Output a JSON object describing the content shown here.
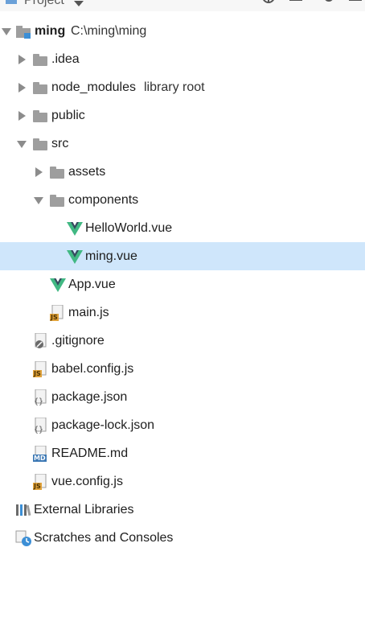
{
  "header": {
    "title": "Project"
  },
  "tree": {
    "root": {
      "label": "ming",
      "path": "C:\\ming\\ming"
    },
    "idea": {
      "label": ".idea"
    },
    "node_modules": {
      "label": "node_modules",
      "extra": "library root"
    },
    "public": {
      "label": "public"
    },
    "src": {
      "label": "src"
    },
    "assets": {
      "label": "assets"
    },
    "components": {
      "label": "components"
    },
    "helloworld": {
      "label": "HelloWorld.vue"
    },
    "ming_vue": {
      "label": "ming.vue"
    },
    "app_vue": {
      "label": "App.vue"
    },
    "main_js": {
      "label": "main.js"
    },
    "gitignore": {
      "label": ".gitignore"
    },
    "babel_config": {
      "label": "babel.config.js"
    },
    "package_json": {
      "label": "package.json"
    },
    "package_lock": {
      "label": "package-lock.json"
    },
    "readme": {
      "label": "README.md"
    },
    "vue_config": {
      "label": "vue.config.js"
    },
    "external_libraries": {
      "label": "External Libraries"
    },
    "scratches": {
      "label": "Scratches and Consoles"
    }
  },
  "colors": {
    "selection": "#cfe6fb",
    "vue_green": "#41b883",
    "vue_dark": "#35495e",
    "folder": "#9e9e9e"
  }
}
